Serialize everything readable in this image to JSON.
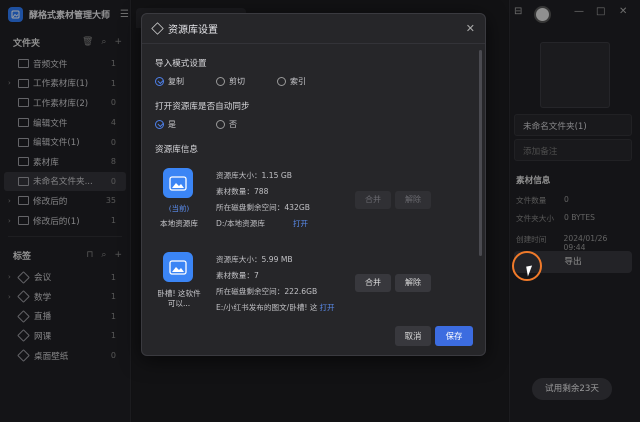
{
  "app": {
    "title": "酵格式素材管理大师"
  },
  "sidebar": {
    "folders_header": "文件夹",
    "folders": [
      {
        "label": "音频文件",
        "count": "1",
        "arrow": ""
      },
      {
        "label": "工作素材库(1)",
        "count": "1",
        "arrow": "›"
      },
      {
        "label": "工作素材库(2)",
        "count": "0",
        "arrow": ""
      },
      {
        "label": "编辑文件",
        "count": "4",
        "arrow": ""
      },
      {
        "label": "编辑文件(1)",
        "count": "0",
        "arrow": ""
      },
      {
        "label": "素材库",
        "count": "8",
        "arrow": ""
      },
      {
        "label": "未命名文件夹...",
        "count": "0",
        "arrow": "",
        "selected": true
      },
      {
        "label": "修改后的",
        "count": "35",
        "arrow": "›"
      },
      {
        "label": "修改后的(1)",
        "count": "1",
        "arrow": "›"
      }
    ],
    "tags_header": "标签",
    "tags": [
      {
        "label": "会议",
        "count": "1",
        "arrow": "›"
      },
      {
        "label": "数学",
        "count": "1",
        "arrow": "›"
      },
      {
        "label": "直播",
        "count": "1",
        "arrow": ""
      },
      {
        "label": "网课",
        "count": "1",
        "arrow": ""
      },
      {
        "label": "桌面壁纸",
        "count": "0",
        "arrow": ""
      }
    ]
  },
  "right": {
    "folder_name": "未命名文件夹(1)",
    "note_placeholder": "添加备注",
    "info_header": "素材信息",
    "rows": [
      {
        "k": "文件数量",
        "v": "0"
      },
      {
        "k": "文件夹大小",
        "v": "0 BYTES"
      },
      {
        "k": "创建时间",
        "v": "2024/01/26 09:44"
      }
    ],
    "export": "导出",
    "trial": "试用剩余23天"
  },
  "modal": {
    "title": "资源库设置",
    "import_mode_label": "导入模式设置",
    "import_modes": [
      "复制",
      "剪切",
      "索引"
    ],
    "sync_label": "打开资源库是否自动同步",
    "sync_options": [
      "是",
      "否"
    ],
    "lib_info_label": "资源库信息",
    "libraries": [
      {
        "name": "本地资源库",
        "current": "(当前)",
        "size": "资源库大小：1.15 GB",
        "count": "素材数量：788",
        "free": "所在磁盘剩余空间：432GB",
        "path": "D:/本地资源库",
        "open": "打开",
        "merge": "合并",
        "remove": "解除",
        "enabled": false
      },
      {
        "name": "卧槽! 这软件可以...",
        "current": "",
        "size": "资源库大小：5.99 MB",
        "count": "素材数量：7",
        "free": "所在磁盘剩余空间：222.6GB",
        "path": "E:/小红书发布的图文/卧槽! 这",
        "open": "打开",
        "merge": "合并",
        "remove": "解除",
        "enabled": true
      }
    ],
    "cancel": "取消",
    "save": "保存"
  }
}
